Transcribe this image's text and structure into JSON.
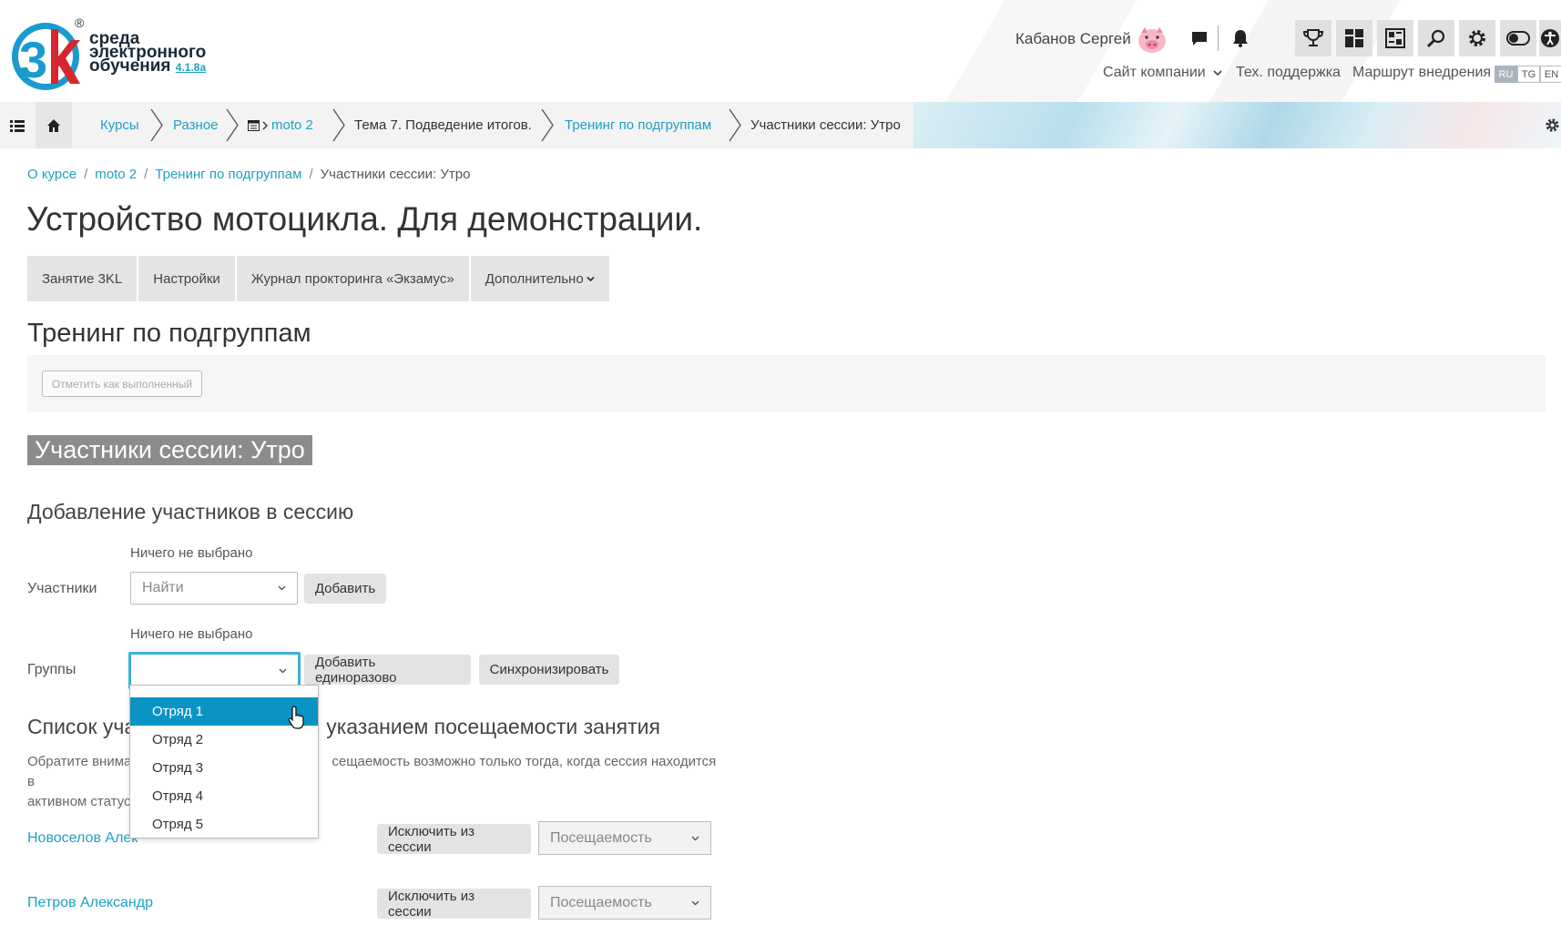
{
  "header": {
    "logo_lines": [
      "среда",
      "электронного",
      "обучения"
    ],
    "logo_registered": "®",
    "logo_version": "4.1.8a",
    "user_name": "Кабанов Сергей",
    "links": [
      "Сайт компании",
      "Тех. поддержка",
      "Маршрут внедрения"
    ],
    "languages": [
      "RU",
      "TG",
      "EN"
    ],
    "active_language": "RU"
  },
  "navbar": {
    "items": [
      "Курсы",
      "Разное",
      "moto 2",
      "Тема 7. Подведение итогов.",
      "Тренинг по подгруппам",
      "Участники сессии: Утро"
    ]
  },
  "breadcrumb": [
    "О курсе",
    "moto 2",
    "Тренинг по подгруппам",
    "Участники сессии: Утро"
  ],
  "page_title": "Устройство мотоцикла. Для демонстрации.",
  "tabs": [
    "Занятие 3KL",
    "Настройки",
    "Журнал прокторинга «Экзамус»",
    "Дополнительно"
  ],
  "module_title": "Тренинг по подгруппам",
  "mark_done_label": "Отметить как выполненный",
  "session_title": "Участники сессии: Утро",
  "add_section": {
    "title": "Добавление участников в сессию",
    "participants_label": "Участники",
    "participants_hint": "Ничего не выбрано",
    "participants_placeholder": "Найти",
    "add_button": "Добавить",
    "groups_label": "Группы",
    "groups_hint": "Ничего не выбрано",
    "groups_value": "",
    "add_once_button": "Добавить единоразово",
    "sync_button": "Синхронизировать",
    "group_options": [
      "Отряд 1",
      "Отряд 2",
      "Отряд 3",
      "Отряд 4",
      "Отряд 5"
    ],
    "highlighted_option": "Отряд 1"
  },
  "list_section": {
    "title_left": "Список уча",
    "title_right": "указанием посещаемости занятия",
    "note_line1_left": "Обратите внима",
    "note_line1_right": "сещаемость возможно только тогда, когда сессия находится в",
    "note_line2": "активном статус",
    "participants": [
      {
        "name": "Новоселов Алек",
        "exclude_label": "Исключить из сессии",
        "attendance_placeholder": "Посещаемость"
      },
      {
        "name": "Петров Александр",
        "exclude_label": "Исключить из сессии",
        "attendance_placeholder": "Посещаемость"
      }
    ]
  },
  "colors": {
    "accent": "#1fa0c4",
    "selected_option": "#0a94c4",
    "focus_border": "#39b2d9",
    "logo_blue": "#1a9bd0",
    "logo_red": "#d7262d"
  }
}
